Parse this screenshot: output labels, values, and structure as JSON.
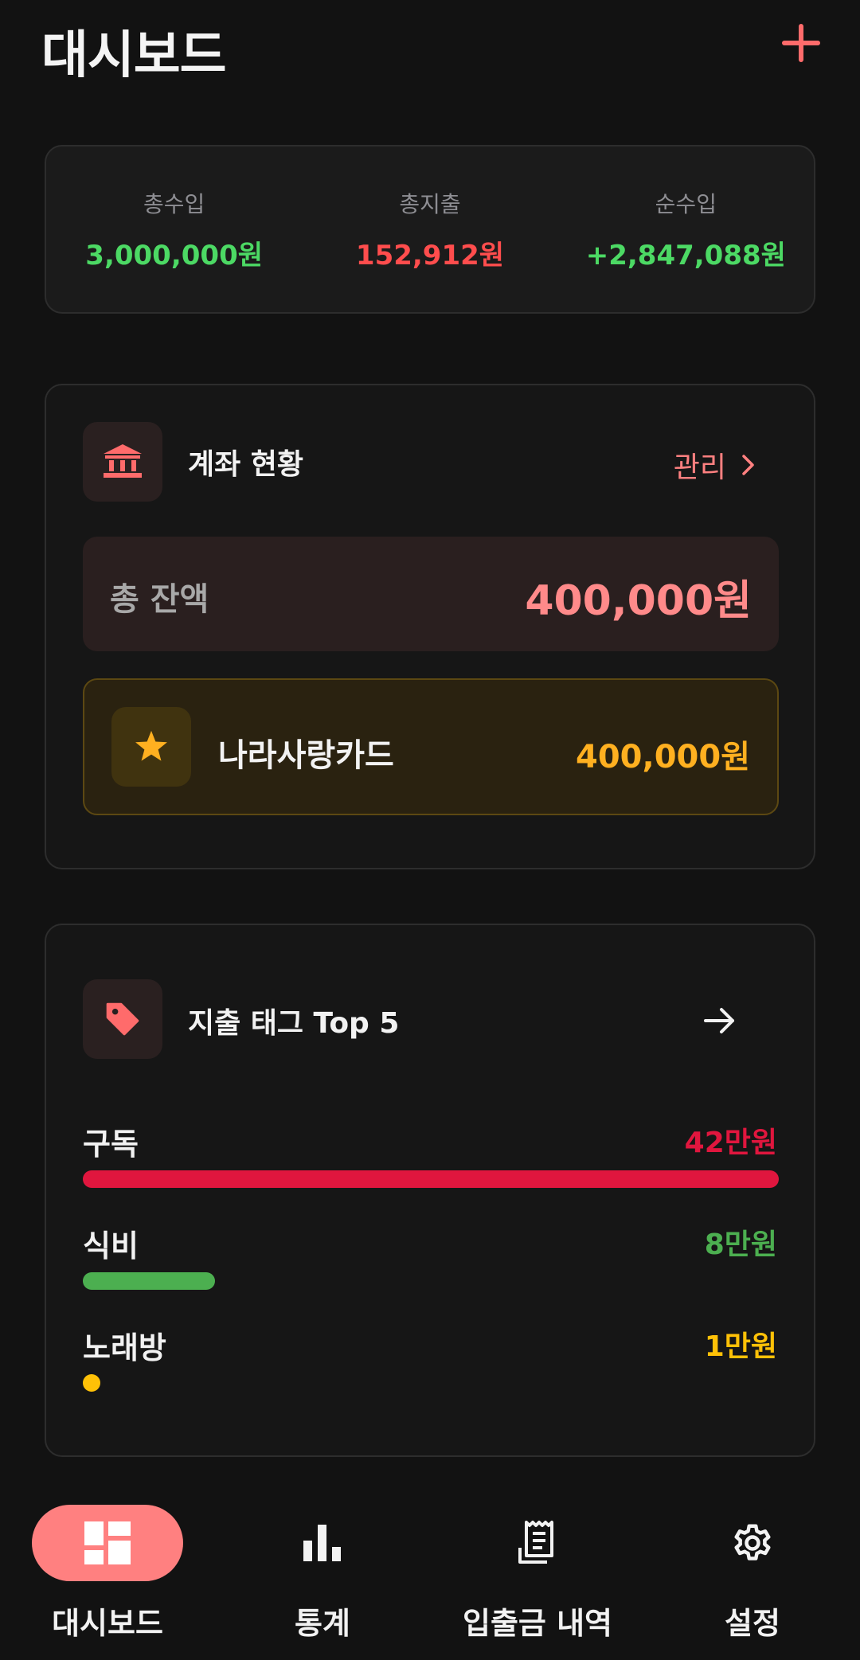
{
  "header": {
    "title": "대시보드"
  },
  "summary": {
    "income_label": "총수입",
    "income_value": "3,000,000원",
    "expense_label": "총지출",
    "expense_value": "152,912원",
    "net_label": "순수입",
    "net_value": "+2,847,088원"
  },
  "accounts": {
    "title": "계좌 현황",
    "manage_label": "관리",
    "total_label": "총 잔액",
    "total_value": "400,000원",
    "items": [
      {
        "name": "나라사랑카드",
        "value": "400,000원",
        "icon": "star-icon"
      }
    ]
  },
  "tags": {
    "title": "지출 태그 Top 5",
    "items": [
      {
        "label": "구독",
        "value": "42만원",
        "color": "#e0163e",
        "fraction": 1.0
      },
      {
        "label": "식비",
        "value": "8만원",
        "color": "#4caf50",
        "fraction": 0.19
      },
      {
        "label": "노래방",
        "value": "1만원",
        "color": "#ffc107",
        "fraction": 0.024
      }
    ]
  },
  "nav": {
    "items": [
      {
        "label": "대시보드",
        "icon": "dashboard-icon",
        "active": true
      },
      {
        "label": "통계",
        "icon": "bar-chart-icon",
        "active": false
      },
      {
        "label": "입출금 내역",
        "icon": "receipt-icon",
        "active": false
      },
      {
        "label": "설정",
        "icon": "gear-icon",
        "active": false
      }
    ]
  },
  "colors": {
    "accent": "#ff8080",
    "income": "#4cd964",
    "expense": "#ff4d4d",
    "card_gold": "#ffb020"
  }
}
